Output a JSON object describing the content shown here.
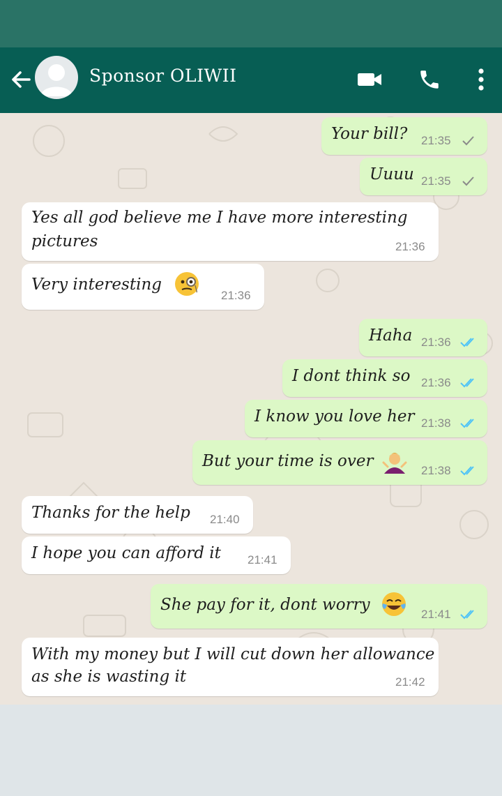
{
  "header": {
    "contact_name": "Sponsor OLIWII",
    "icons": [
      "back-arrow-icon",
      "avatar-placeholder-icon",
      "video-call-icon",
      "voice-call-icon",
      "more-vert-icon"
    ]
  },
  "colors": {
    "header": "#075e54",
    "status_strip": "#2a7366",
    "chat_background": "#ece5dd",
    "outgoing_bubble": "#dcf8c6",
    "incoming_bubble": "#ffffff",
    "read_ticks": "#4fc3f7",
    "sent_tick": "#8a8a8a"
  },
  "messages": [
    {
      "direction": "out",
      "text": "Your bill?",
      "time": "21:35",
      "status": "delivered"
    },
    {
      "direction": "out",
      "text": "Uuuu",
      "time": "21:35",
      "status": "delivered"
    },
    {
      "direction": "in",
      "line1": "Yes all god believe me I have more interesting",
      "line2": "pictures",
      "time": "21:36"
    },
    {
      "direction": "in",
      "text": "Very interesting",
      "emoji": "face-with-monocle-emoji",
      "time": "21:36"
    },
    {
      "direction": "out",
      "text": "Haha",
      "time": "21:36",
      "status": "read"
    },
    {
      "direction": "out",
      "text": "I dont think so",
      "time": "21:36",
      "status": "read"
    },
    {
      "direction": "out",
      "text": "I know you love her",
      "time": "21:38",
      "status": "read"
    },
    {
      "direction": "out",
      "text": "But your time is over",
      "emoji": "person-shrugging-emoji",
      "time": "21:38",
      "status": "read"
    },
    {
      "direction": "in",
      "text": "Thanks for the help",
      "time": "21:40"
    },
    {
      "direction": "in",
      "text": "I hope you can afford it",
      "time": "21:41"
    },
    {
      "direction": "out",
      "text": "She pay for it, dont worry",
      "emoji": "face-with-tears-of-joy-emoji",
      "time": "21:41",
      "status": "read"
    },
    {
      "direction": "in",
      "line1": "With my money but I will cut down her allowance",
      "line2": "as she is wasting it",
      "time": "21:42"
    }
  ]
}
